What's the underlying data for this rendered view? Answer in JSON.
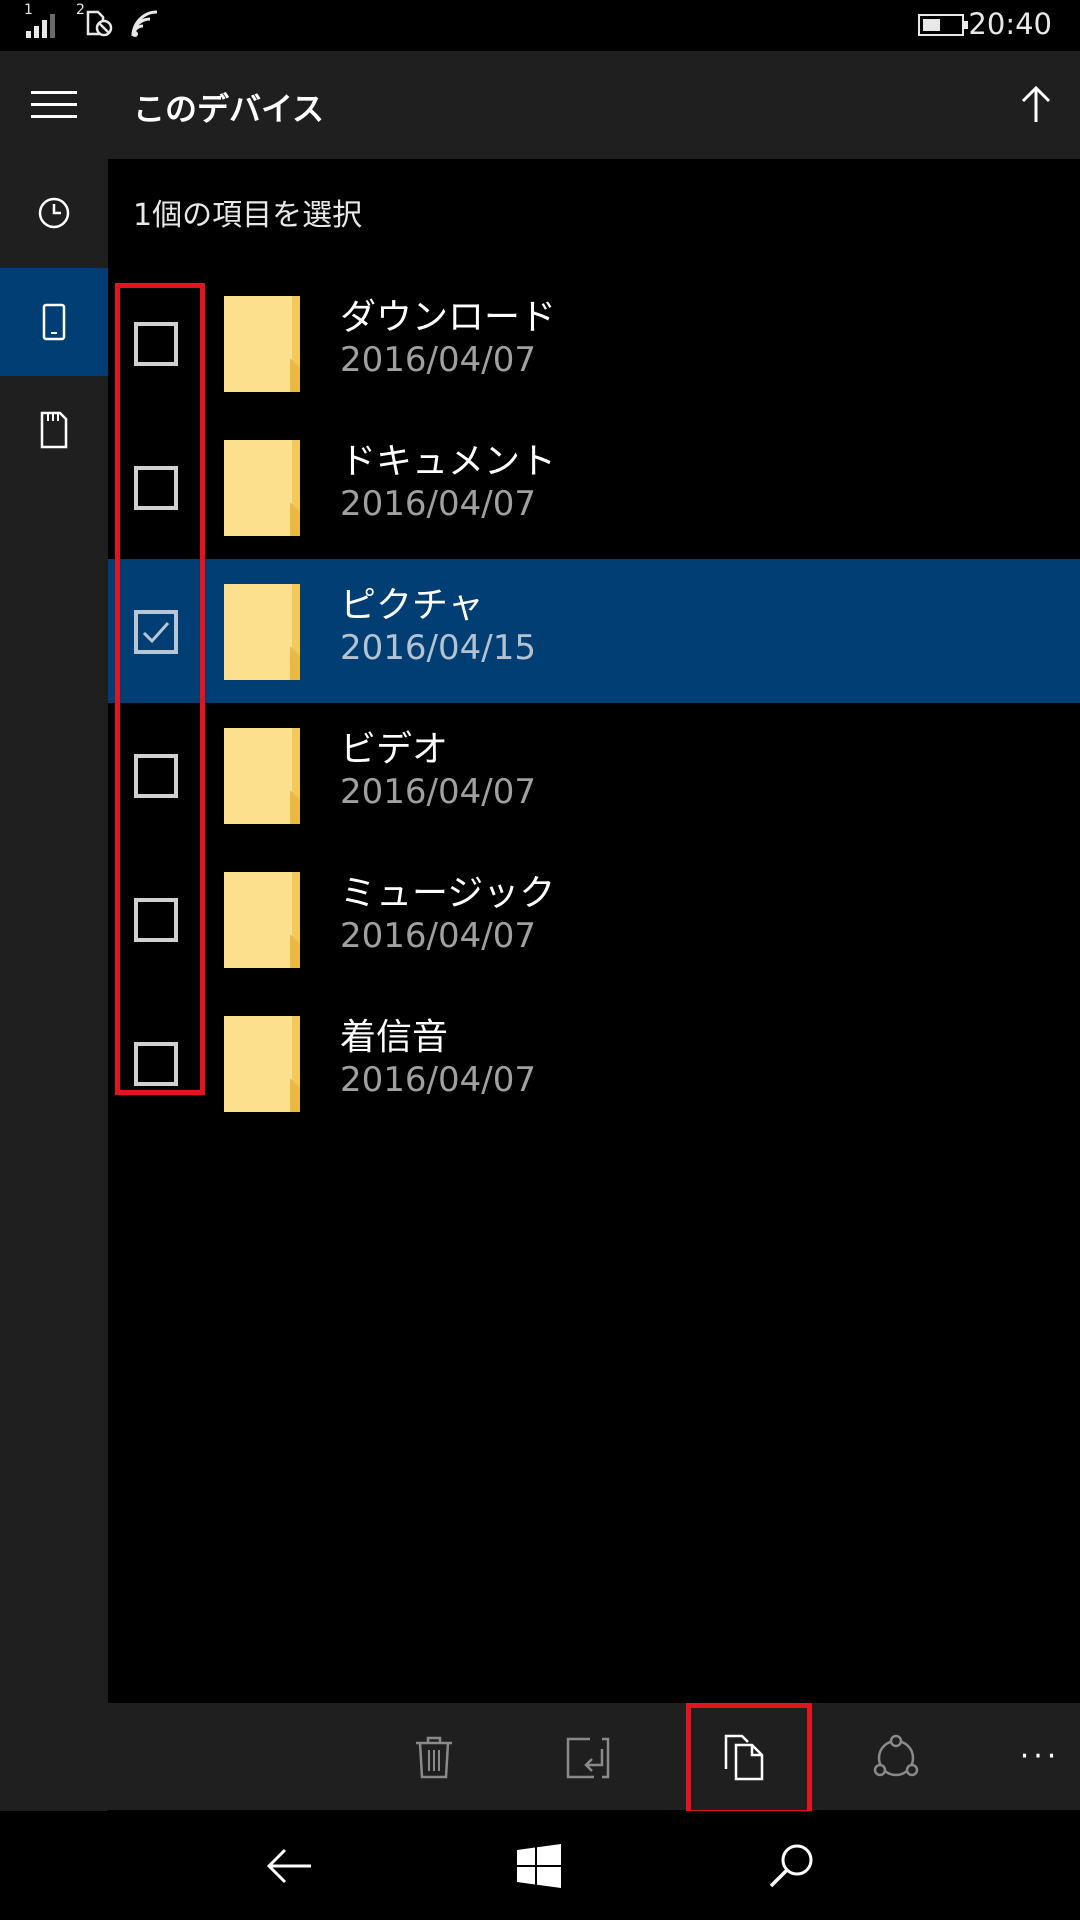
{
  "status_bar": {
    "sim1_label": "1",
    "sim2_label": "2",
    "time": "20:40",
    "battery_level": 0.45
  },
  "header": {
    "title": "このデバイス"
  },
  "selection_count": "1個の項目を選択",
  "items": [
    {
      "name": "ダウンロード",
      "date": "2016/04/07",
      "checked": false
    },
    {
      "name": "ドキュメント",
      "date": "2016/04/07",
      "checked": false
    },
    {
      "name": "ピクチャ",
      "date": "2016/04/15",
      "checked": true
    },
    {
      "name": "ビデオ",
      "date": "2016/04/07",
      "checked": false
    },
    {
      "name": "ミュージック",
      "date": "2016/04/07",
      "checked": false
    },
    {
      "name": "着信音",
      "date": "2016/04/07",
      "checked": false
    }
  ],
  "command_bar": {
    "buttons": [
      "trash-icon",
      "move-icon",
      "copy-icon",
      "share-icon"
    ],
    "more_label": "···"
  },
  "nav_bar": {
    "buttons": [
      "back-arrow-icon",
      "windows-logo-icon",
      "search-icon"
    ]
  },
  "colors": {
    "accent": "#003e73",
    "panel": "#1f1f1f",
    "highlight": "#e3131f",
    "folder": "#f8d775"
  }
}
